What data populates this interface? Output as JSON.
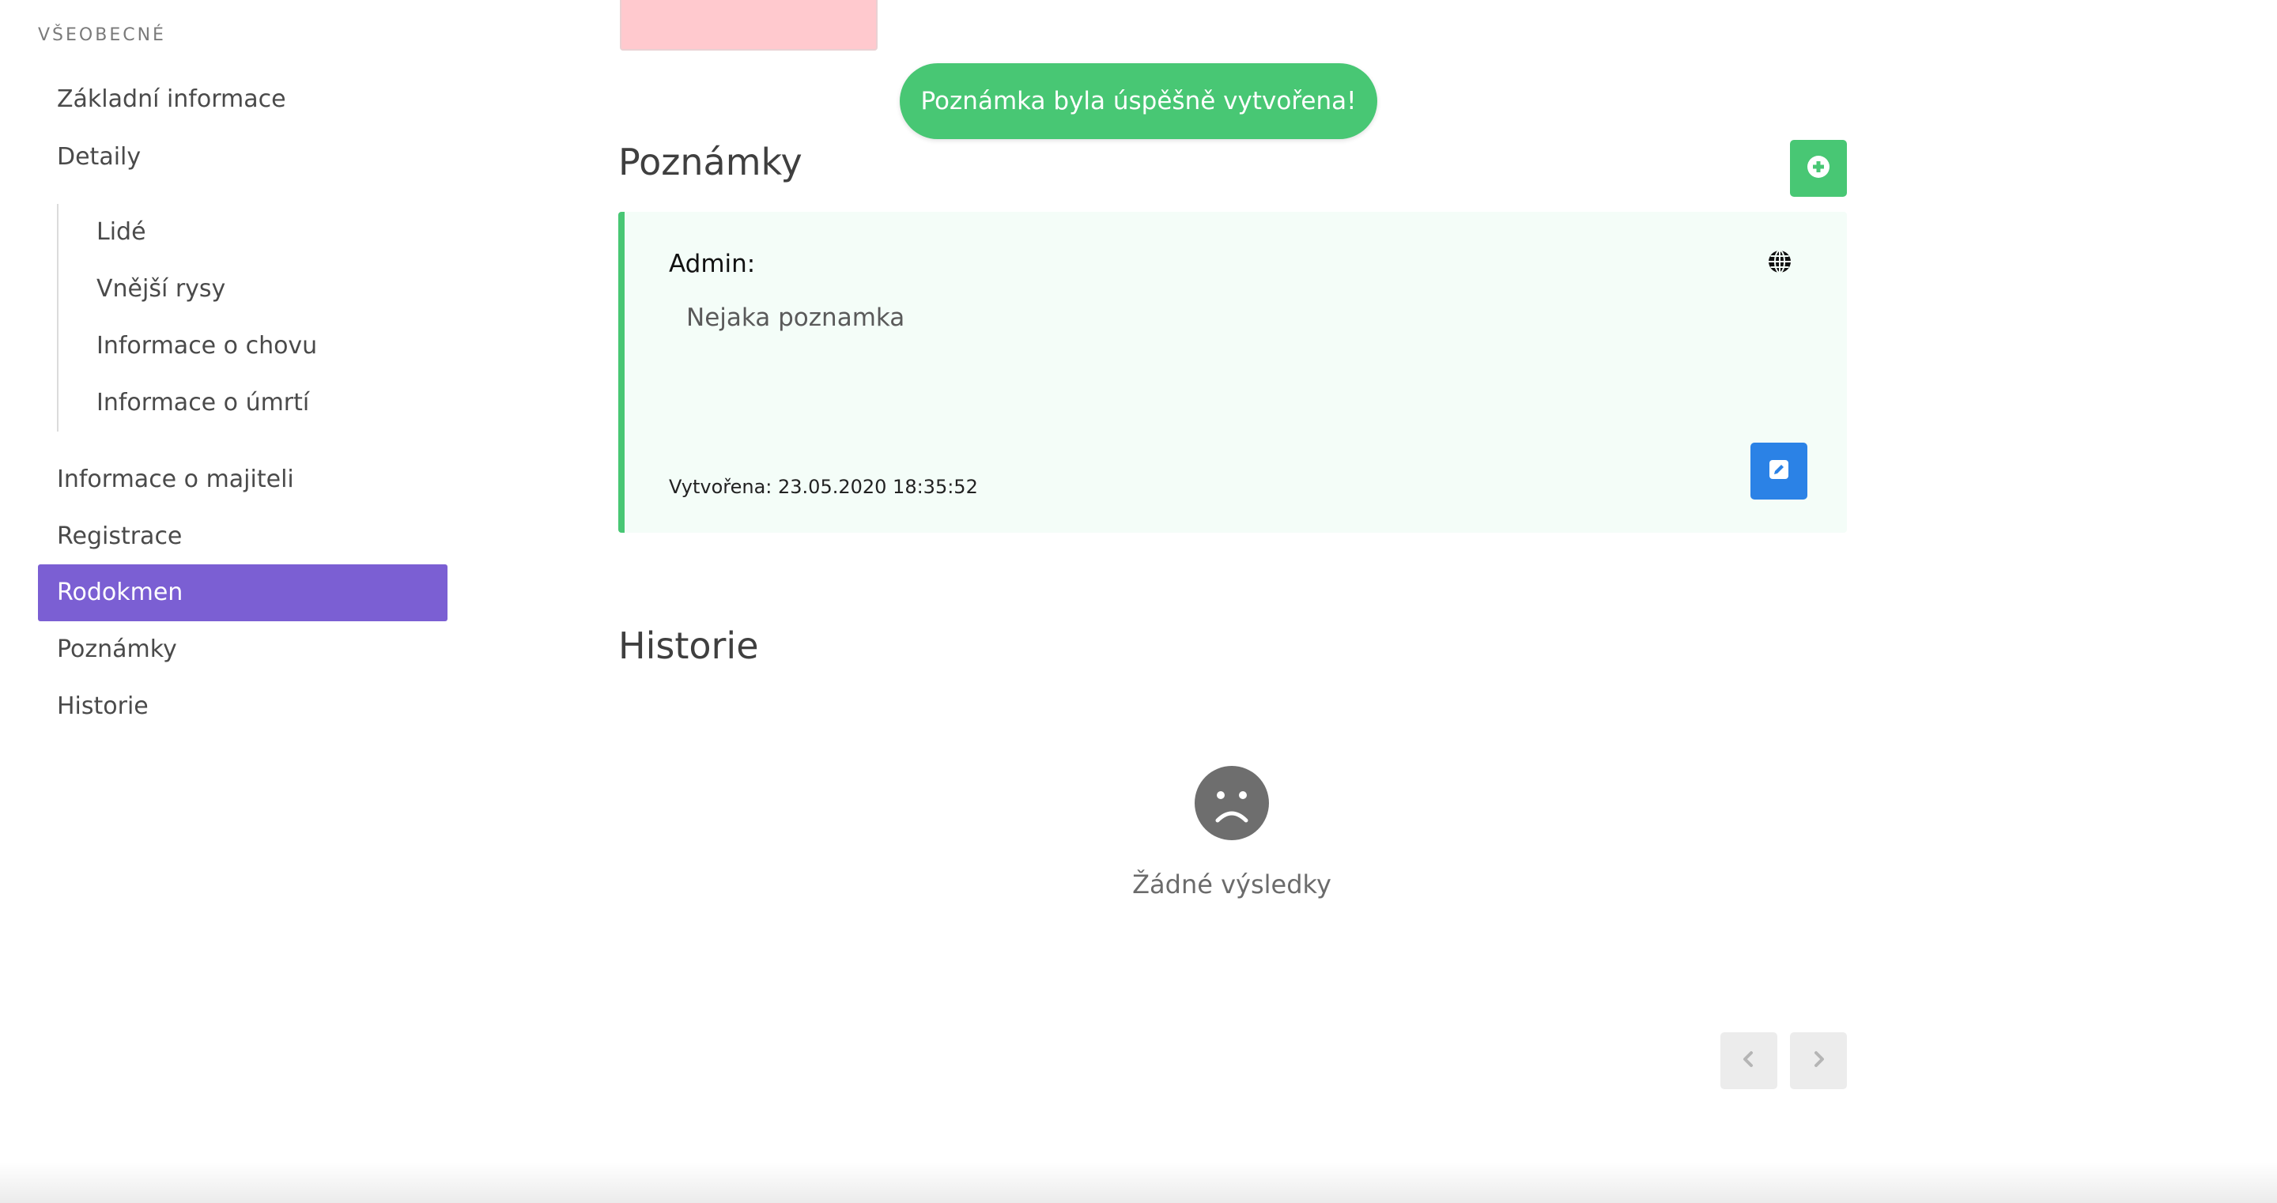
{
  "sidebar": {
    "section_label": "VŠEOBECNÉ",
    "items": [
      {
        "label": "Základní informace"
      },
      {
        "label": "Detaily"
      },
      {
        "label": "Informace o majiteli"
      },
      {
        "label": "Registrace"
      },
      {
        "label": "Rodokmen",
        "active": true
      },
      {
        "label": "Poznámky"
      },
      {
        "label": "Historie"
      }
    ],
    "subitems": [
      {
        "label": "Lidé"
      },
      {
        "label": "Vnější rysy"
      },
      {
        "label": "Informace o chovu"
      },
      {
        "label": "Informace o úmrtí"
      }
    ],
    "active_color": "#7b5fd3"
  },
  "toast": {
    "message": "Poznámka byla úspěšně vytvořena!",
    "color": "#48c774"
  },
  "notes": {
    "title": "Poznámky",
    "add_icon": "plus-circle-icon",
    "items": [
      {
        "author": "Admin:",
        "text": "Nejaka poznamka",
        "created": "Vytvořena: 23.05.2020 18:35:52",
        "visibility_icon": "globe-icon",
        "edit_icon": "edit-icon"
      }
    ]
  },
  "history": {
    "title": "Historie",
    "empty_icon": "sad-face-icon",
    "empty_text": "Žádné výsledky"
  },
  "pagination": {
    "prev_icon": "chevron-left-icon",
    "next_icon": "chevron-right-icon"
  },
  "colors": {
    "success": "#48c774",
    "primary": "#2b82e6",
    "accent": "#7b5fd3"
  }
}
